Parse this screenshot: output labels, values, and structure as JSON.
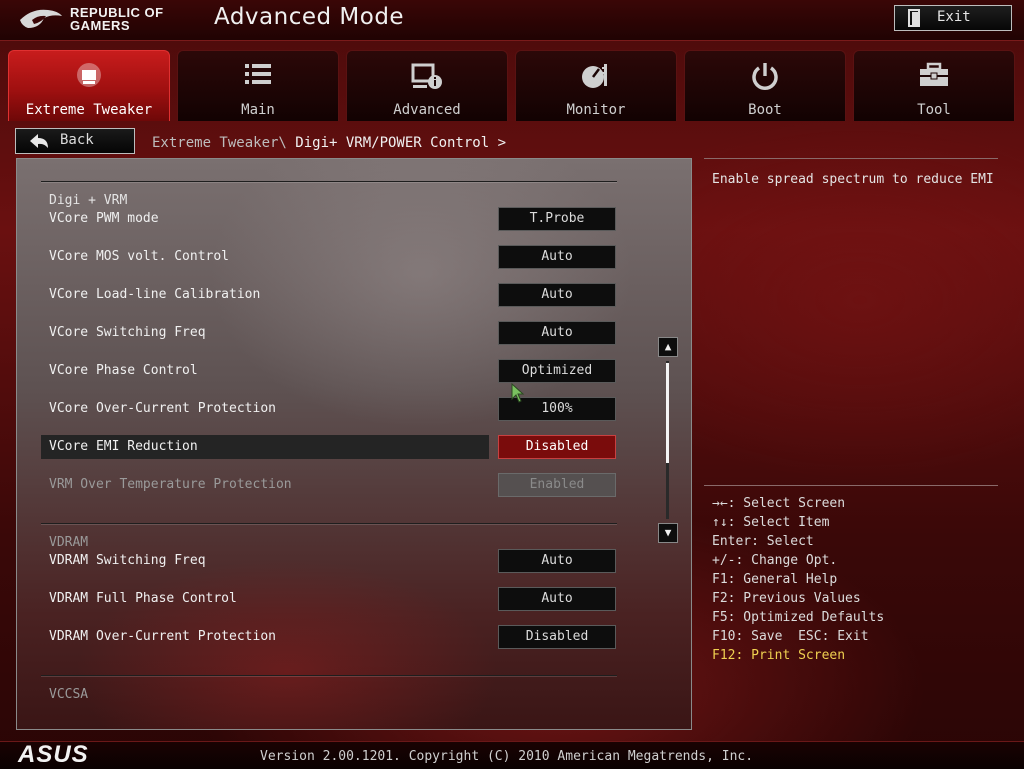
{
  "header": {
    "brand_line1": "REPUBLIC OF",
    "brand_line2": "GAMERS",
    "mode": "Advanced Mode",
    "exit_label": "Exit",
    "exit_icon": "exit-door-icon"
  },
  "tabs": [
    {
      "label": "Extreme Tweaker",
      "icon": "tweaker-icon",
      "active": true
    },
    {
      "label": "Main",
      "icon": "list-icon",
      "active": false
    },
    {
      "label": "Advanced",
      "icon": "advanced-info-icon",
      "active": false
    },
    {
      "label": "Monitor",
      "icon": "monitor-gauge-icon",
      "active": false
    },
    {
      "label": "Boot",
      "icon": "power-icon",
      "active": false
    },
    {
      "label": "Tool",
      "icon": "toolbox-icon",
      "active": false
    }
  ],
  "nav": {
    "back_label": "Back",
    "breadcrumb_parent": "Extreme Tweaker\\",
    "breadcrumb_current": " Digi+ VRM/POWER Control >"
  },
  "sections": {
    "digi": {
      "title": "Digi + VRM",
      "rows": [
        {
          "label": "VCore PWM mode",
          "value": "T.Probe"
        },
        {
          "label": "VCore MOS volt. Control",
          "value": "Auto"
        },
        {
          "label": "VCore Load-line Calibration",
          "value": "Auto"
        },
        {
          "label": "VCore Switching Freq",
          "value": "Auto"
        },
        {
          "label": "VCore Phase Control",
          "value": "Optimized"
        },
        {
          "label": "VCore Over-Current Protection",
          "value": "100%"
        },
        {
          "label": "VCore EMI Reduction",
          "value": "Disabled",
          "selected": true
        },
        {
          "label": "VRM Over Temperature Protection",
          "value": "Enabled",
          "disabled": true
        }
      ]
    },
    "vdram": {
      "title": "VDRAM",
      "rows": [
        {
          "label": "VDRAM Switching Freq",
          "value": "Auto"
        },
        {
          "label": "VDRAM Full Phase Control",
          "value": "Auto"
        },
        {
          "label": "VDRAM Over-Current Protection",
          "value": "Disabled"
        }
      ]
    },
    "vccsa": {
      "title": "VCCSA"
    }
  },
  "help": {
    "text": "Enable spread spectrum to reduce EMI"
  },
  "keys": [
    "→←: Select Screen",
    "↑↓: Select Item",
    "Enter: Select",
    "+/-: Change Opt.",
    "F1: General Help",
    "F2: Previous Values",
    "F5: Optimized Defaults",
    "F10: Save  ESC: Exit",
    "F12: Print Screen"
  ],
  "footer": {
    "brand": "ASUS",
    "version": "Version 2.00.1201. Copyright (C) 2010 American Megatrends, Inc."
  },
  "colors": {
    "accent_red": "#c81c1c",
    "selected_value_bg": "#7a0c0c",
    "highlight_key": "#f0d050"
  }
}
